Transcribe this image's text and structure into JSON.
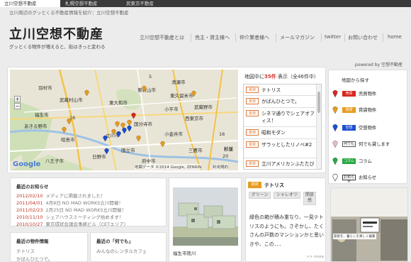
{
  "top_tabs": [
    "立川空想不動産",
    "札幌空想不動産",
    "尻東京不動産"
  ],
  "header": {
    "tagline": "立川周辺のグッとくる不動産情報を紹介：立川空想不動産",
    "logo": "立川空想不動産",
    "logo_sub": "グッとくる物件が増えると、街はきっと変わる",
    "powered": "powered by 空想不動産"
  },
  "nav": [
    "立川空想不動産とは",
    "売主・貸主様へ",
    "仲介業者様へ",
    "メールマガジン",
    "twitter",
    "お問い合わせ",
    "home"
  ],
  "map": {
    "labels": [
      "羽村市",
      "東村山市",
      "清瀬市",
      "武蔵村山市",
      "東大和市",
      "東久留米市",
      "福生市",
      "小平市",
      "西東京市",
      "あきる野市",
      "昭島市",
      "立川市",
      "国分寺市",
      "小金井市",
      "武蔵野市",
      "八王子市",
      "日野市",
      "府中市",
      "国立市",
      "三鷹市",
      "杉並"
    ],
    "route_labels": [
      "5",
      "16",
      "16",
      "20"
    ],
    "zoom_in": "+",
    "zoom_out": "−",
    "brand": "Google",
    "attribution": "地図データ ©2014 Google, ZENRIN",
    "terms": "利用規約"
  },
  "listing_count": {
    "prefix": "地図中に",
    "count": "35件",
    "suffix": " 表示（全46件中）"
  },
  "listings": [
    {
      "tag": "賃貸",
      "title": "テトリス"
    },
    {
      "tag": "賃貸",
      "title": "かばんひとつで。"
    },
    {
      "tag": "賃貸",
      "title": "シネマ通りでシェアオフィス！"
    },
    {
      "tag": "賃貸",
      "title": "昭和モダン"
    },
    {
      "tag": "賃貸",
      "title": "ザラッとしたリノベ#2"
    },
    {
      "tag": "賃貸",
      "title": "立川アメリカンふたたび"
    }
  ],
  "legend": {
    "title": "地図から探す",
    "items": [
      {
        "tag": "売買",
        "label": "売買物件",
        "color": "#d8261d"
      },
      {
        "tag": "賃貸",
        "label": "賃貸物件",
        "color": "#e69b21"
      },
      {
        "tag": "空想",
        "label": "空想物件",
        "color": "#1b4fcf"
      },
      {
        "tag": "何でも",
        "label": "何でも貸します",
        "color": "#c23b8a"
      },
      {
        "tag": "コラム",
        "label": "コラム",
        "color": "#27a843"
      },
      {
        "tag": "お知らせ",
        "label": "お知らせ",
        "color": "#ffffff"
      }
    ]
  },
  "recent_news": {
    "title": "最近のお知らせ",
    "items": [
      {
        "date": "2012/02/10",
        "text": "メディアに掲載されました！"
      },
      {
        "date": "2011/04/01",
        "text": "4月8日 NO MAD WORKS立川開催！"
      },
      {
        "date": "2011/02/23",
        "text": "2月25日 NO MAD WORKS立川開催！"
      },
      {
        "date": "2010/11/10",
        "text": "シェアハウスミーティング始めます！"
      },
      {
        "date": "2010/10/27",
        "text": "東京環状会議会事務ビル（CETエリア）"
      }
    ]
  },
  "recent_properties": {
    "title": "最近の物件情報",
    "items": [
      "テトリス",
      "かばんひとつで。"
    ]
  },
  "recent_anything": {
    "title": "最近の「何でも」",
    "items": [
      "みんなのレンタルカフェ"
    ]
  },
  "photo_caption": "福生市熊川",
  "feature": {
    "tag": "賃貸",
    "title": "テトリス",
    "chips": [
      "グリーン",
      "シャレオツ",
      "開放感"
    ],
    "text": "緑色の箱が積み重なり、一見テトリスのようにも。さぞかし、たくさんの戸数のマンションかと思いきや、この．．．",
    "more": ">> more"
  },
  "ad_text": "部屋を、暮らしを楽しく編集",
  "colors": {
    "accent": "#d0312d",
    "rent": "#e69b21",
    "dark_bar": "#3a3a3a"
  }
}
